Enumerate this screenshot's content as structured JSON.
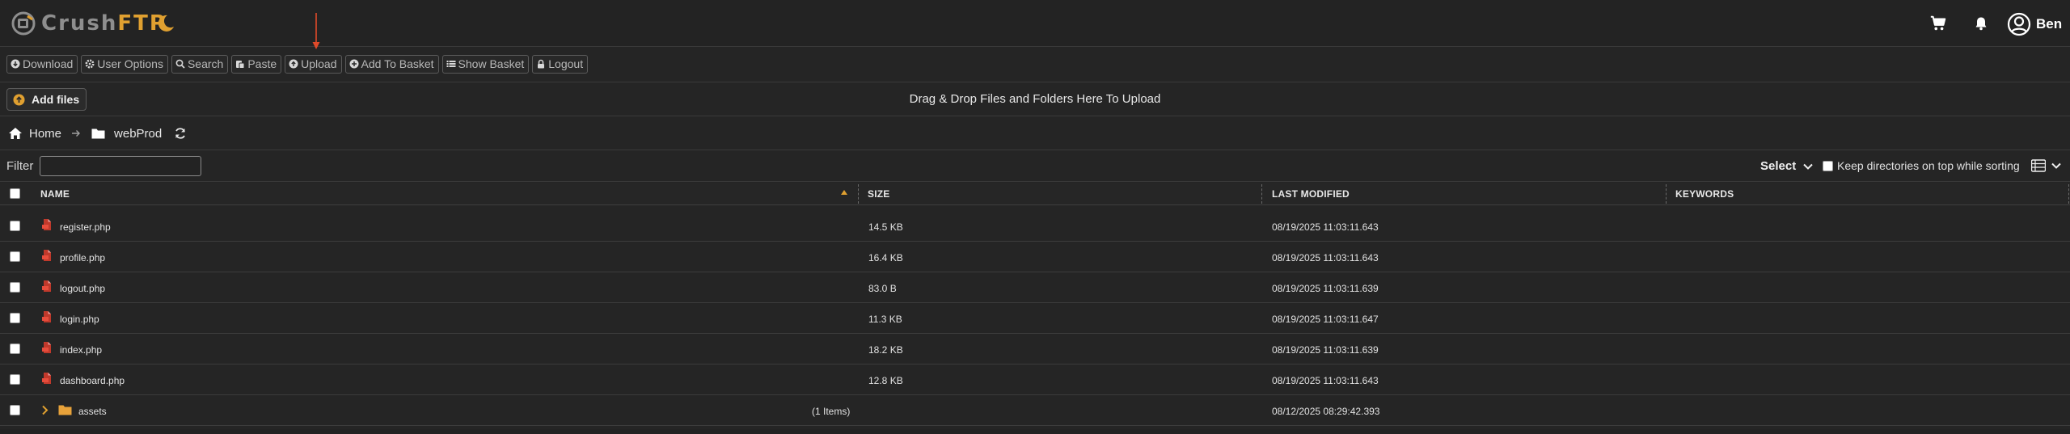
{
  "header": {
    "logo_crush": "Crush",
    "logo_ftp": "FTP",
    "user_name": "Ben"
  },
  "toolbar": {
    "buttons": [
      {
        "label": "Download",
        "icon": "download-icon"
      },
      {
        "label": "User Options",
        "icon": "gear-icon"
      },
      {
        "label": "Search",
        "icon": "search-icon"
      },
      {
        "label": "Paste",
        "icon": "paste-icon"
      },
      {
        "label": "Upload",
        "icon": "upload-icon"
      },
      {
        "label": "Add To Basket",
        "icon": "plus-icon"
      },
      {
        "label": "Show Basket",
        "icon": "list-icon"
      },
      {
        "label": "Logout",
        "icon": "lock-icon"
      }
    ]
  },
  "upload": {
    "add_files_label": "Add files",
    "drop_text": "Drag & Drop Files and Folders Here To Upload"
  },
  "breadcrumb": {
    "home": "Home",
    "folder": "webProd"
  },
  "filter": {
    "label": "Filter",
    "value": "",
    "select_label": "Select",
    "keep_dirs_label": "Keep directories on top while sorting"
  },
  "table": {
    "columns": [
      "NAME",
      "SIZE",
      "LAST MODIFIED",
      "KEYWORDS"
    ],
    "rows": [
      {
        "name": "register.php",
        "size": "14.5 KB",
        "modified": "08/19/2025 11:03:11.643"
      },
      {
        "name": "profile.php",
        "size": "16.4 KB",
        "modified": "08/19/2025 11:03:11.643"
      },
      {
        "name": "logout.php",
        "size": "83.0 B",
        "modified": "08/19/2025 11:03:11.639"
      },
      {
        "name": "login.php",
        "size": "11.3 KB",
        "modified": "08/19/2025 11:03:11.647"
      },
      {
        "name": "index.php",
        "size": "18.2 KB",
        "modified": "08/19/2025 11:03:11.639"
      },
      {
        "name": "dashboard.php",
        "size": "12.8 KB",
        "modified": "08/19/2025 11:03:11.643"
      }
    ],
    "folder": {
      "name": "assets",
      "items": "(1 Items)",
      "modified": "08/12/2025 08:29:42.393"
    }
  },
  "colors": {
    "accent": "#e0a030",
    "background": "#252525",
    "annotation": "#e04a2a",
    "file_icon": "#c0392b"
  }
}
